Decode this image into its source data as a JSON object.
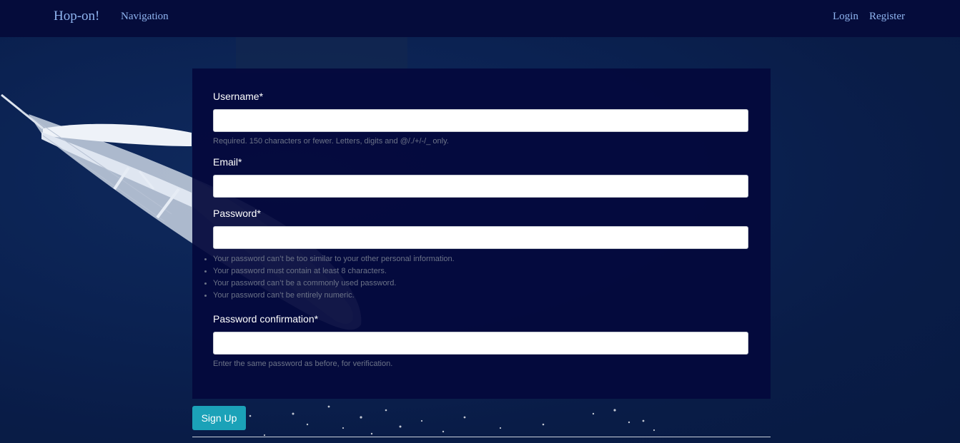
{
  "navbar": {
    "brand": "Hop-on!",
    "navigation": "Navigation",
    "login": "Login",
    "register": "Register"
  },
  "form": {
    "username": {
      "label": "Username*",
      "value": "",
      "help": "Required. 150 characters or fewer. Letters, digits and @/./+/-/_ only."
    },
    "email": {
      "label": "Email*",
      "value": ""
    },
    "password": {
      "label": "Password*",
      "value": "",
      "rules": [
        "Your password can’t be too similar to your other personal information.",
        "Your password must contain at least 8 characters.",
        "Your password can’t be a commonly used password.",
        "Your password can’t be entirely numeric."
      ]
    },
    "password_confirmation": {
      "label": "Password confirmation*",
      "value": "",
      "help": "Enter the same password as before, for verification."
    },
    "submit_label": "Sign Up"
  },
  "colors": {
    "navbar_bg": "#050c3b",
    "link": "#8fb4ef",
    "panel_bg": "#04093c",
    "button_bg": "#1ba2b8",
    "help_text": "#6c7388"
  },
  "background": {
    "image": "sailboat-on-sea"
  }
}
